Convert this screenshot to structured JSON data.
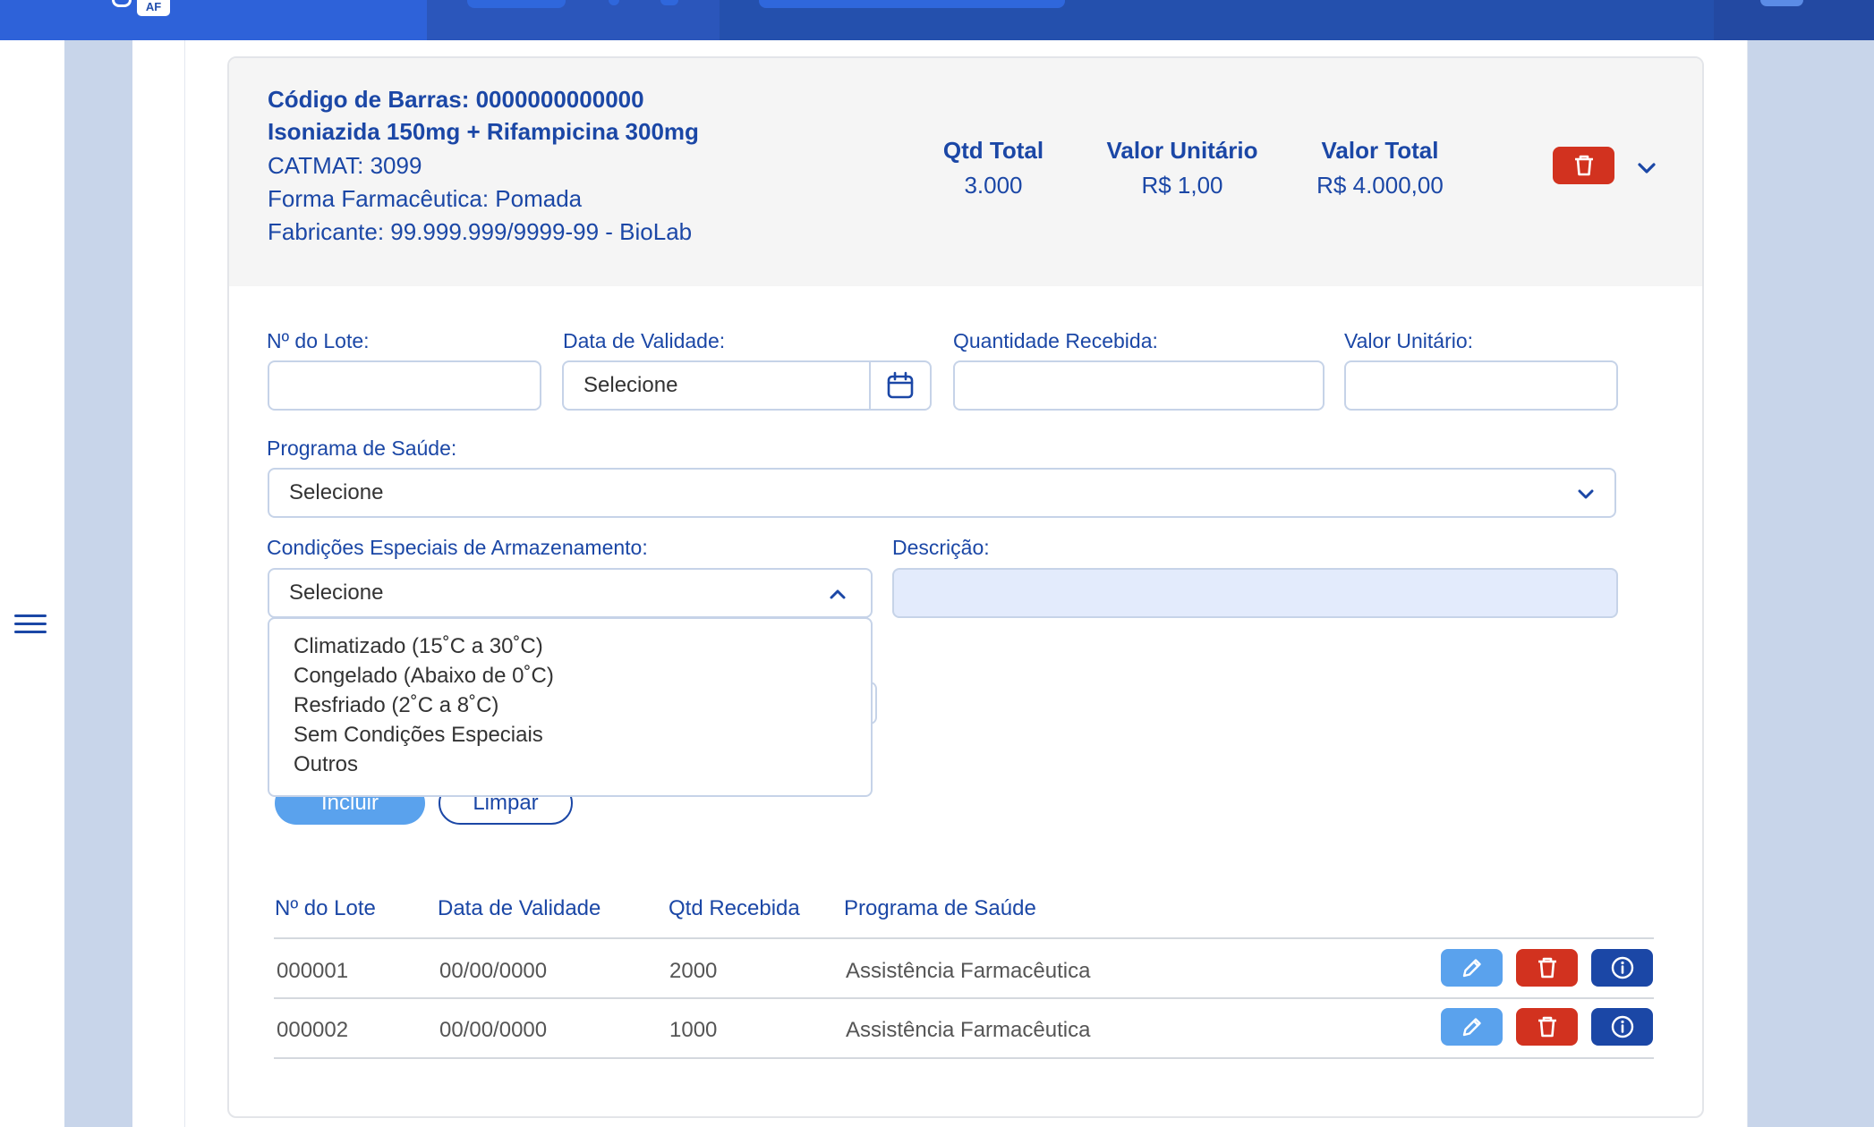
{
  "topbar": {
    "logo_badge": "AF"
  },
  "product": {
    "barcode": "Código de Barras: 0000000000000",
    "name": "Isoniazida 150mg + Rifampicina 300mg",
    "catmat": "CATMAT: 3099",
    "form": "Forma Farmacêutica: Pomada",
    "manufacturer": "Fabricante: 99.999.999/9999-99 - BioLab",
    "qtd_total_label": "Qtd Total",
    "qtd_total_value": "3.000",
    "valor_unitario_label": "Valor Unitário",
    "valor_unitario_value": "R$ 1,00",
    "valor_total_label": "Valor Total",
    "valor_total_value": "R$ 4.000,00"
  },
  "form": {
    "lote_label": "Nº do Lote:",
    "lote_value": "",
    "validade_label": "Data de Validade:",
    "validade_value": "Selecione",
    "quantidade_label": "Quantidade Recebida:",
    "quantidade_value": "",
    "valor_unitario_label": "Valor Unitário:",
    "valor_unitario_value": "",
    "programa_label": "Programa de Saúde:",
    "programa_value": "Selecione",
    "condicoes_label": "Condições Especiais de Armazenamento:",
    "condicoes_value": "Selecione",
    "condicoes_options": [
      "Climatizado (15˚C a 30˚C)",
      "Congelado (Abaixo de 0˚C)",
      "Resfriado (2˚C a 8˚C)",
      "Sem Condições Especiais",
      "Outros"
    ],
    "descricao_label": "Descrição:",
    "descricao_value": "",
    "incluir_label": "Incluir",
    "limpar_label": "Limpar"
  },
  "table": {
    "headers": [
      "Nº do Lote",
      "Data de Validade",
      "Qtd Recebida",
      "Programa de Saúde"
    ],
    "rows": [
      [
        "000001",
        "00/00/0000",
        "2000",
        "Assistência Farmacêutica"
      ],
      [
        "000002",
        "00/00/0000",
        "1000",
        "Assistência Farmacêutica"
      ]
    ]
  },
  "colors": {
    "primary": "#1b47a6",
    "danger": "#d2321f",
    "light_blue": "#5aa2ed",
    "header_bg": "#2450ad"
  },
  "icons": [
    "menu-icon",
    "trash-icon",
    "chevron-down-icon",
    "chevron-up-icon",
    "calendar-icon",
    "pencil-icon",
    "info-icon"
  ]
}
